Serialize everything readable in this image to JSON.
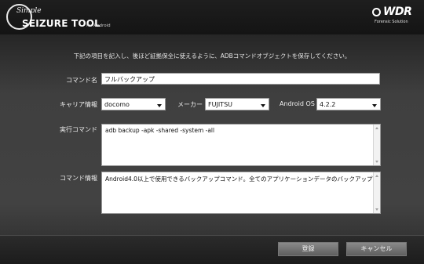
{
  "header": {
    "logo_simple": "Simple",
    "logo_title": "SEIZURE TOOL",
    "logo_sub": "for Android",
    "brand_name": "WDR",
    "brand_tag": "Forensic Solution"
  },
  "instruction": "下記の項目を記入し、後ほど証拠保全に使えるように、ADBコマンドオブジェクトを保存してください。",
  "form": {
    "command_name_label": "コマンド名",
    "command_name_value": "フルバックアップ",
    "carrier_label": "キャリア情報",
    "carrier_value": "docomo",
    "maker_label": "メーカー",
    "maker_value": "FUJITSU",
    "os_label": "Android OS",
    "os_value": "4.2.2",
    "exec_label": "実行コマンド",
    "exec_value": "adb backup -apk -shared -system -all",
    "info_label": "コマンド情報",
    "info_value": "Android4.0以上で使用できるバックアップコマンド。全てのアプリケーションデータのバックアップを作成。"
  },
  "footer": {
    "register_label": "登録",
    "cancel_label": "キャンセル"
  },
  "icons": {
    "logo": "simple-seizure-logo-icon",
    "brand": "wdr-brand-icon",
    "dropdown": "chevron-down-icon"
  }
}
